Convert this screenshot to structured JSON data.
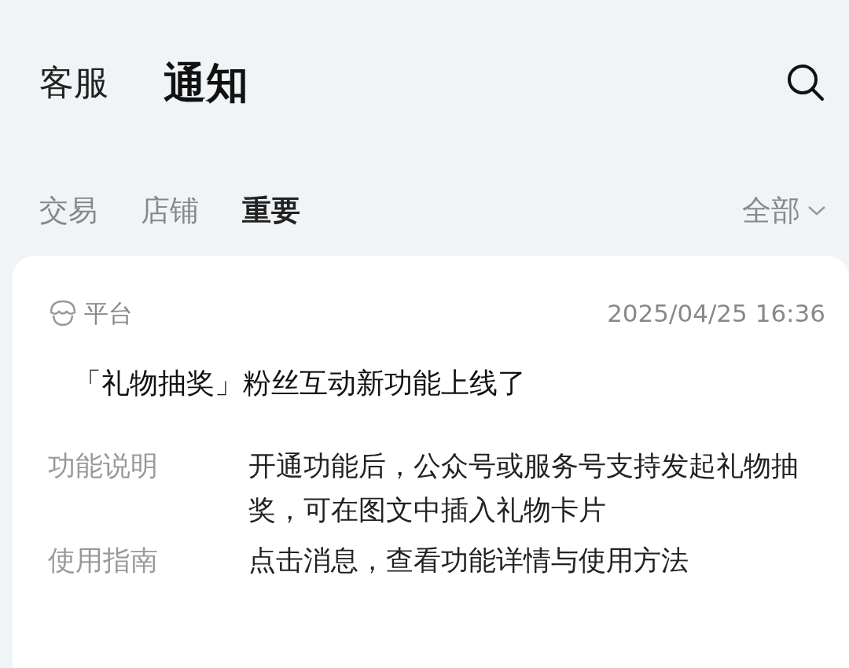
{
  "header_tabs": [
    {
      "label": "客服",
      "selected": false
    },
    {
      "label": "通知",
      "selected": true
    }
  ],
  "filter_tabs": [
    {
      "label": "交易",
      "selected": false
    },
    {
      "label": "店铺",
      "selected": false
    },
    {
      "label": "重要",
      "selected": true
    }
  ],
  "filter_dropdown": {
    "label": "全部"
  },
  "notification": {
    "source": "平台",
    "time": "2025/04/25 16:36",
    "title": "「礼物抽奖」粉丝互动新功能上线了",
    "details": [
      {
        "label": "功能说明",
        "text": "开通功能后，公众号或服务号支持发起礼物抽奖，可在图文中插入礼物卡片"
      },
      {
        "label": "使用指南",
        "text": "点击消息，查看功能详情与使用方法"
      }
    ]
  }
}
